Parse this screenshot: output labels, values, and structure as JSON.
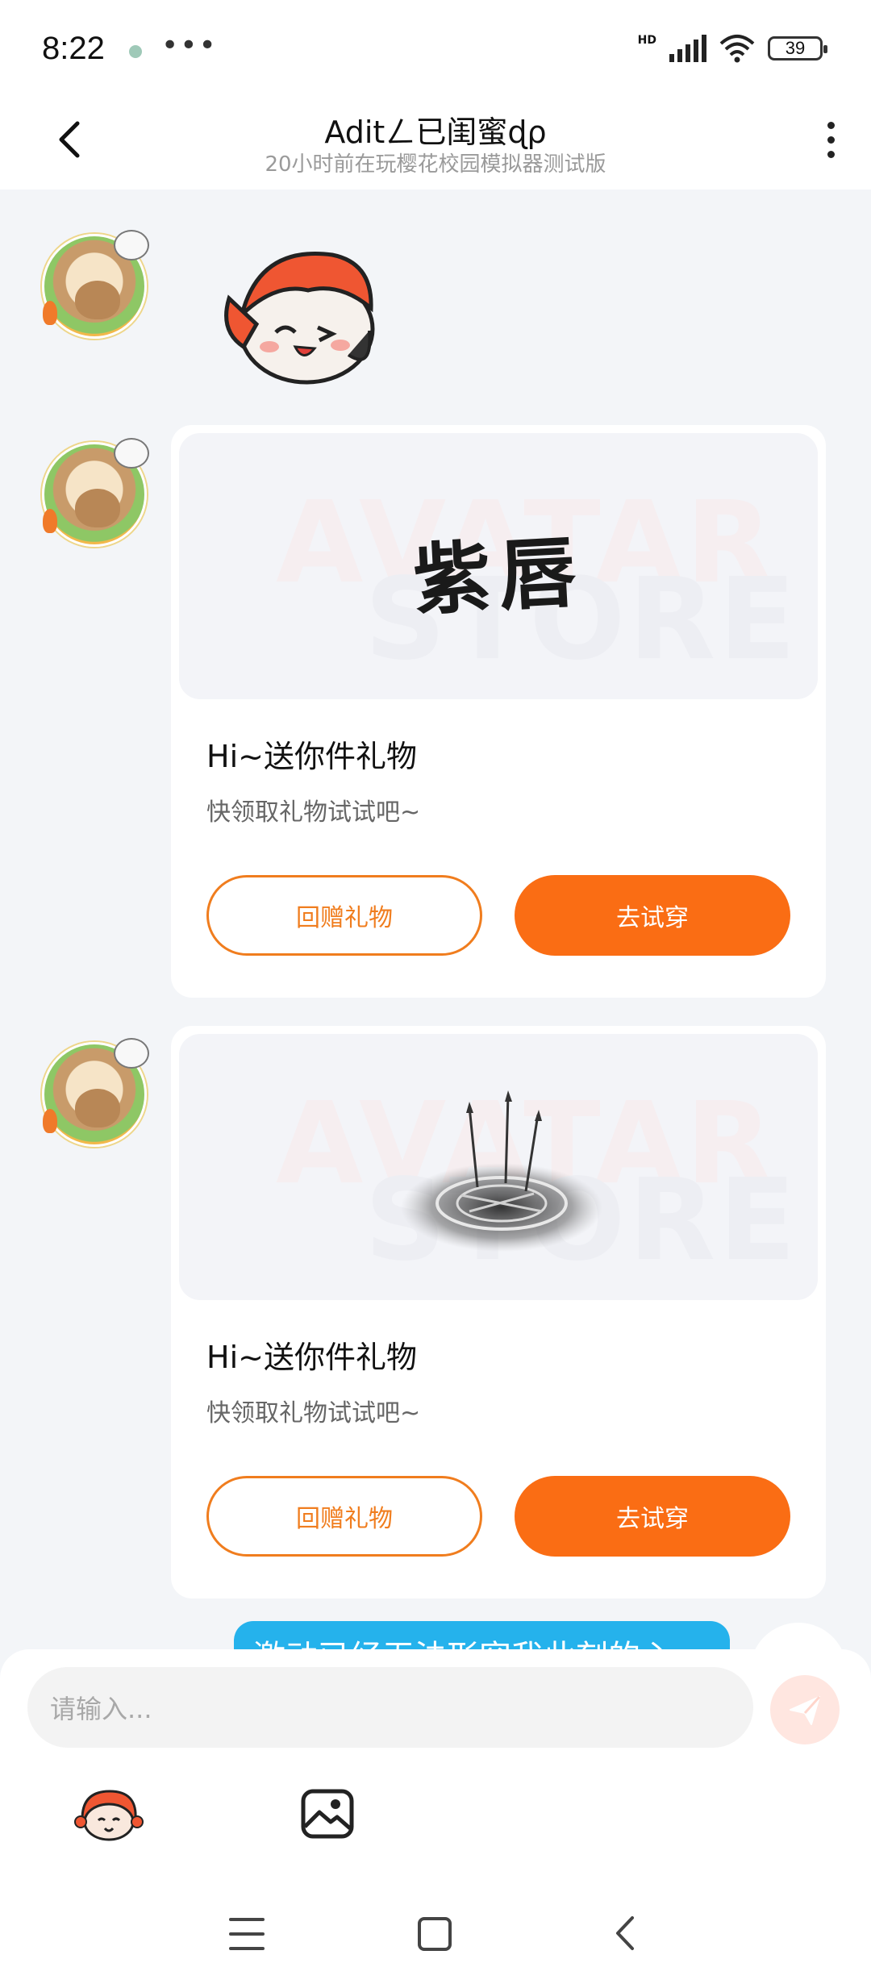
{
  "status_bar": {
    "time": "8:22",
    "more": "•••",
    "network": "HD",
    "battery": "39"
  },
  "header": {
    "title": "Aditㄥ已闺蜜ɖρ",
    "subtitle": "20小时前在玩樱花校园模拟器测试版"
  },
  "messages": {
    "gift1": {
      "preview_text": "紫唇",
      "watermark_line1": "AVATAR",
      "watermark_line2": "STORE",
      "title": "Hi~送你件礼物",
      "desc": "快领取礼物试试吧~",
      "return_label": "回赠礼物",
      "try_label": "去试穿"
    },
    "gift2": {
      "watermark_line1": "AVATAR",
      "watermark_line2": "STORE",
      "title": "Hi~送你件礼物",
      "desc": "快领取礼物试试吧~",
      "return_label": "回赠礼物",
      "try_label": "去试穿"
    },
    "outgoing_partial": "激动已经无法形容我此刻的心"
  },
  "input": {
    "placeholder": "请输入..."
  },
  "icons": {
    "back": "back-arrow-icon",
    "more": "more-vertical-icon",
    "send": "send-icon",
    "sticker": "sticker-icon",
    "image": "image-icon"
  },
  "colors": {
    "accent_orange": "#fa6d14",
    "bubble_blue": "#25b2ec",
    "background": "#f3f5f8"
  }
}
